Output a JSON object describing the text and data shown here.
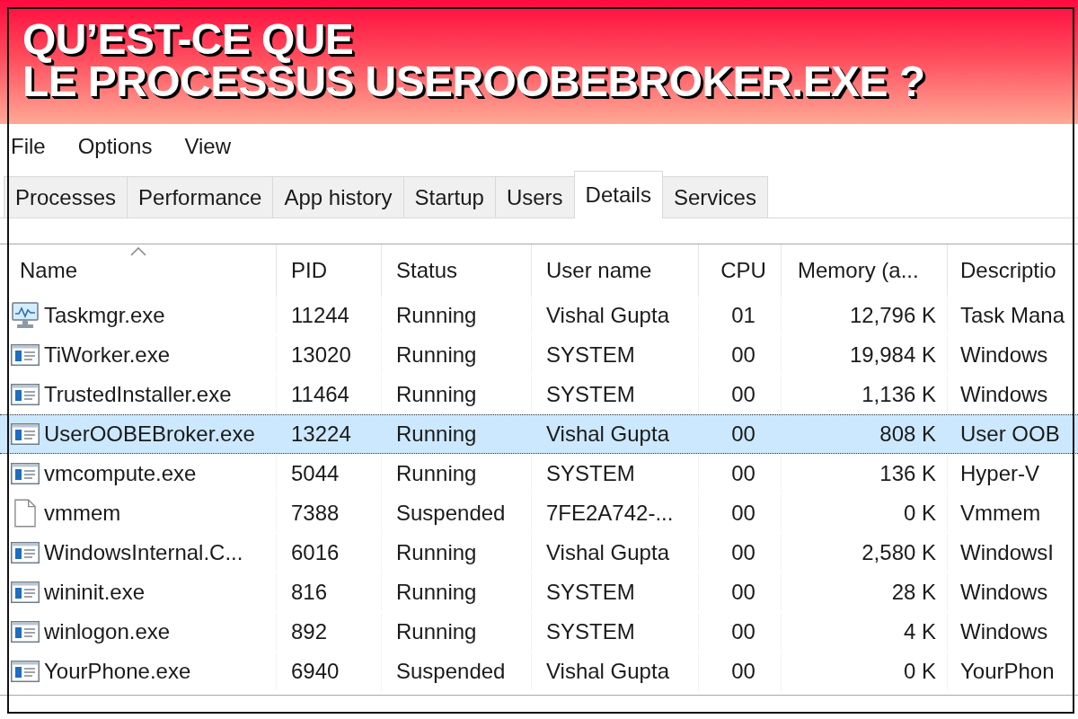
{
  "banner": {
    "title_lines": [
      "QU’EST-CE QUE",
      "LE PROCESSUS USEROOBEBROKER.EXE ?"
    ]
  },
  "menu": [
    "File",
    "Options",
    "View"
  ],
  "tabs": [
    {
      "label": "Processes",
      "selected": false
    },
    {
      "label": "Performance",
      "selected": false
    },
    {
      "label": "App history",
      "selected": false
    },
    {
      "label": "Startup",
      "selected": false
    },
    {
      "label": "Users",
      "selected": false
    },
    {
      "label": "Details",
      "selected": true
    },
    {
      "label": "Services",
      "selected": false
    }
  ],
  "table": {
    "columns": [
      {
        "label": "Name",
        "sorted": true
      },
      {
        "label": "PID",
        "sorted": false
      },
      {
        "label": "Status",
        "sorted": false
      },
      {
        "label": "User name",
        "sorted": false
      },
      {
        "label": "CPU",
        "sorted": false
      },
      {
        "label": "Memory (a...",
        "sorted": false
      },
      {
        "label": "Descriptio",
        "sorted": false
      }
    ],
    "rows": [
      {
        "kind": "monitor",
        "selected": false,
        "cells": [
          "Taskmgr.exe",
          "11244",
          "Running",
          "Vishal Gupta",
          "01",
          "12,796 K",
          "Task Mana"
        ]
      },
      {
        "kind": "window",
        "selected": false,
        "cells": [
          "TiWorker.exe",
          "13020",
          "Running",
          "SYSTEM",
          "00",
          "19,984 K",
          "Windows"
        ]
      },
      {
        "kind": "window",
        "selected": false,
        "cells": [
          "TrustedInstaller.exe",
          "11464",
          "Running",
          "SYSTEM",
          "00",
          "1,136 K",
          "Windows"
        ]
      },
      {
        "kind": "window",
        "selected": true,
        "cells": [
          "UserOOBEBroker.exe",
          "13224",
          "Running",
          "Vishal Gupta",
          "00",
          "808 K",
          "User OOB"
        ]
      },
      {
        "kind": "window",
        "selected": false,
        "cells": [
          "vmcompute.exe",
          "5044",
          "Running",
          "SYSTEM",
          "00",
          "136 K",
          "Hyper-V"
        ]
      },
      {
        "kind": "document",
        "selected": false,
        "cells": [
          "vmmem",
          "7388",
          "Suspended",
          "7FE2A742-...",
          "00",
          "0 K",
          "Vmmem"
        ]
      },
      {
        "kind": "window",
        "selected": false,
        "cells": [
          "WindowsInternal.C...",
          "6016",
          "Running",
          "Vishal Gupta",
          "00",
          "2,580 K",
          "WindowsI"
        ]
      },
      {
        "kind": "window",
        "selected": false,
        "cells": [
          "wininit.exe",
          "816",
          "Running",
          "SYSTEM",
          "00",
          "28 K",
          "Windows"
        ]
      },
      {
        "kind": "window",
        "selected": false,
        "cells": [
          "winlogon.exe",
          "892",
          "Running",
          "SYSTEM",
          "00",
          "4 K",
          "Windows"
        ]
      },
      {
        "kind": "window",
        "selected": false,
        "cells": [
          "YourPhone.exe",
          "6940",
          "Suspended",
          "Vishal Gupta",
          "00",
          "0 K",
          "YourPhon"
        ]
      }
    ]
  }
}
